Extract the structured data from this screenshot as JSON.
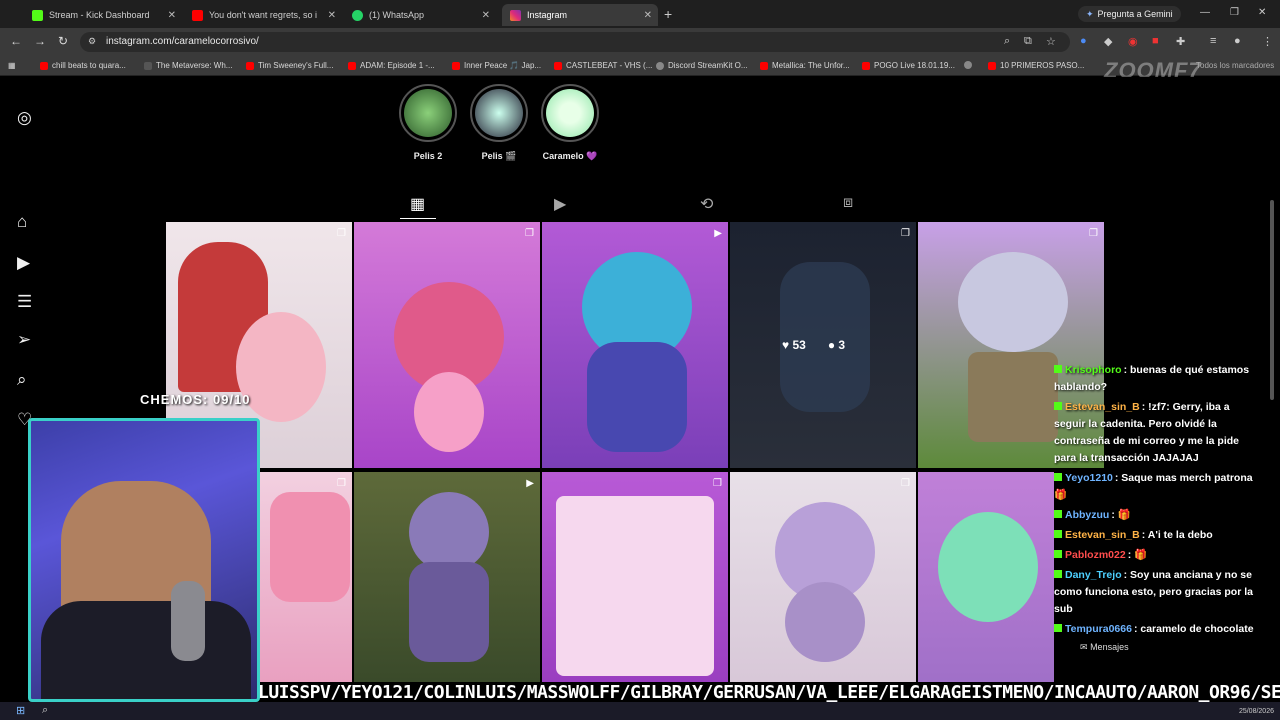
{
  "browser": {
    "tabs": [
      {
        "label": "Stream - Kick Dashboard",
        "color": "#53fc18"
      },
      {
        "label": "You don't want regrets, so i",
        "color": "#ff0000"
      },
      {
        "label": "(1) WhatsApp",
        "color": "#25d366"
      },
      {
        "label": "Instagram",
        "color": "#e1306c"
      }
    ],
    "gemini_label": "Pregunta a Gemini",
    "url": "instagram.com/caramelocorrosivo/",
    "bookmarks": [
      {
        "label": "chill beats to quara...",
        "color": "#ff0000"
      },
      {
        "label": "The Metaverse: Wh...",
        "color": "#555555"
      },
      {
        "label": "Tim Sweeney's Full...",
        "color": "#ff0000"
      },
      {
        "label": "ADAM: Episode 1 -...",
        "color": "#ff0000"
      },
      {
        "label": "Inner Peace 🎵 Jap...",
        "color": "#ff0000"
      },
      {
        "label": "CASTLEBEAT - VHS (...",
        "color": "#ff0000"
      },
      {
        "label": "Discord StreamKit O...",
        "color": "#888888"
      },
      {
        "label": "Metallica: The Unfor...",
        "color": "#ff0000"
      },
      {
        "label": "POGO Live 18.01.19...",
        "color": "#ff0000"
      },
      {
        "label": "",
        "color": "#888888"
      },
      {
        "label": "10 PRIMEROS PASO...",
        "color": "#ff0000"
      }
    ],
    "all_bookmarks_label": "Todos los marcadores"
  },
  "overlay": {
    "logo": "ZOOMF7",
    "counter": "CHEMOS: 09/10",
    "ticker": "LUISSPV/YEYO121/COLINLUIS/MASSWOLFF/GILBRAY/GERRUSAN/VA_LEEE/ELGARAGEISTMENO/INCAAUTO/AARON_OR96/SERRANO",
    "date": "25/08/2026"
  },
  "instagram": {
    "highlights": [
      {
        "label": "Pelis 2"
      },
      {
        "label": "Pelis 🎬"
      },
      {
        "label": "Caramelo 💜"
      }
    ],
    "hover_stats": {
      "likes": "53",
      "comments": "3"
    },
    "messages_label": "Mensajes"
  },
  "chat": [
    {
      "user": "Krisophoro",
      "user_color": "#53fc18",
      "text": ": buenas de qué estamos hablando?"
    },
    {
      "user": "Estevan_sin_B",
      "user_color": "#ffb347",
      "text": ": !zf7: Gerry, iba a seguir la cadenita. Pero olvidé la contraseña de mi correo y me la pide para la transacción JAJAJAJ"
    },
    {
      "user": "Yeyo1210",
      "user_color": "#6fb4ff",
      "text": ": Saque mas merch patrona 🎁"
    },
    {
      "user": "Abbyzuu",
      "user_color": "#6fb4ff",
      "text": ": 🎁"
    },
    {
      "user": "Estevan_sin_B",
      "user_color": "#ffb347",
      "text": ": A'i te la debo"
    },
    {
      "user": "Pablozm022",
      "user_color": "#ff4d4d",
      "text": ": 🎁"
    },
    {
      "user": "Dany_Trejo",
      "user_color": "#4dd0ff",
      "text": ": Soy una anciana y no se como funciona esto, pero gracias por la sub"
    },
    {
      "user": "Tempura0666",
      "user_color": "#6fb4ff",
      "text": ": caramelo de chocolate"
    }
  ]
}
